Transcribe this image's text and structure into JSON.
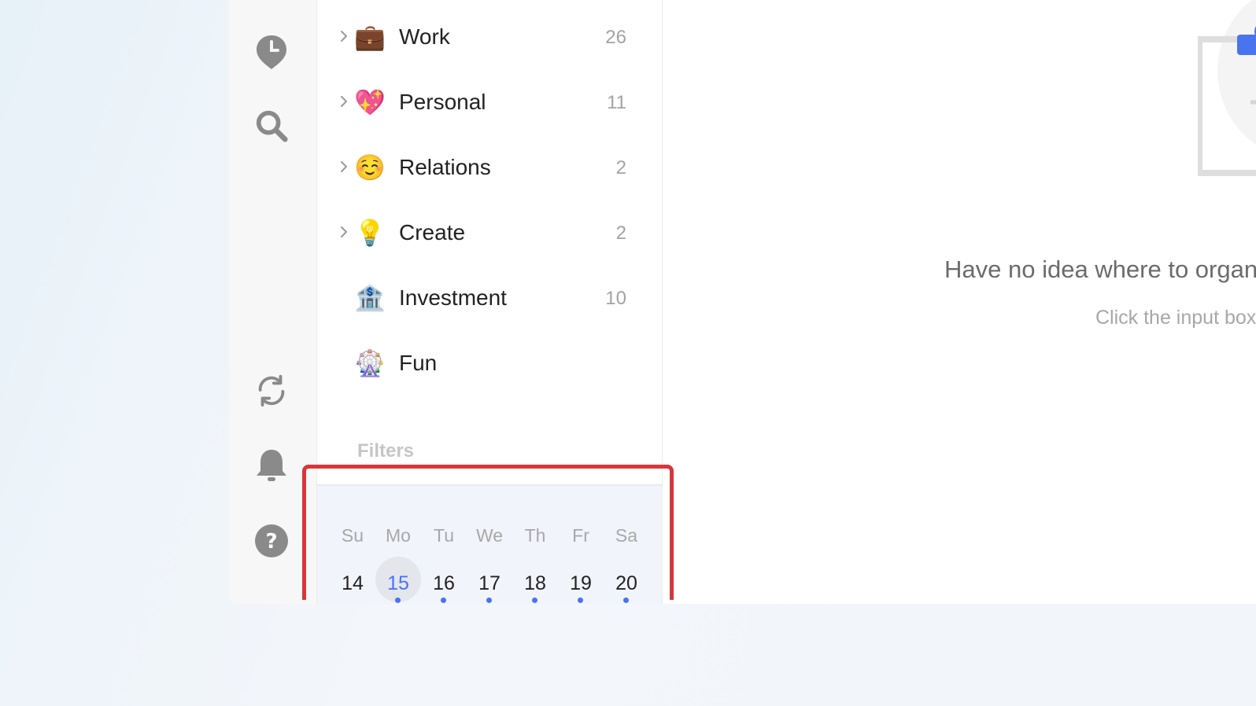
{
  "nav_rail": {
    "icons": [
      "clock-icon",
      "search-icon",
      "sync-icon",
      "bell-icon",
      "help-icon"
    ]
  },
  "lists": [
    {
      "emoji": "💼",
      "label": "Work",
      "count": "26",
      "expandable": true
    },
    {
      "emoji": "💖",
      "label": "Personal",
      "count": "11",
      "expandable": true
    },
    {
      "emoji": "☺️",
      "label": "Relations",
      "count": "2",
      "expandable": true
    },
    {
      "emoji": "💡",
      "label": "Create",
      "count": "2",
      "expandable": true
    },
    {
      "emoji": "🏦",
      "label": "Investment",
      "count": "10",
      "expandable": false
    },
    {
      "emoji": "🎡",
      "label": "Fun",
      "count": "",
      "expandable": false
    }
  ],
  "filters_heading": "Filters",
  "calendar": {
    "day_names": [
      "Su",
      "Mo",
      "Tu",
      "We",
      "Th",
      "Fr",
      "Sa"
    ],
    "dates": [
      "14",
      "15",
      "16",
      "17",
      "18",
      "19",
      "20"
    ],
    "today": "15",
    "accent": "#4a73f0"
  },
  "empty_state": {
    "title": "Have no idea where to organize the tasks? Ad",
    "subtitle": "Click the input box to write them down."
  },
  "colors": {
    "accent": "#4a73f0",
    "highlight_border": "#d8363a"
  }
}
